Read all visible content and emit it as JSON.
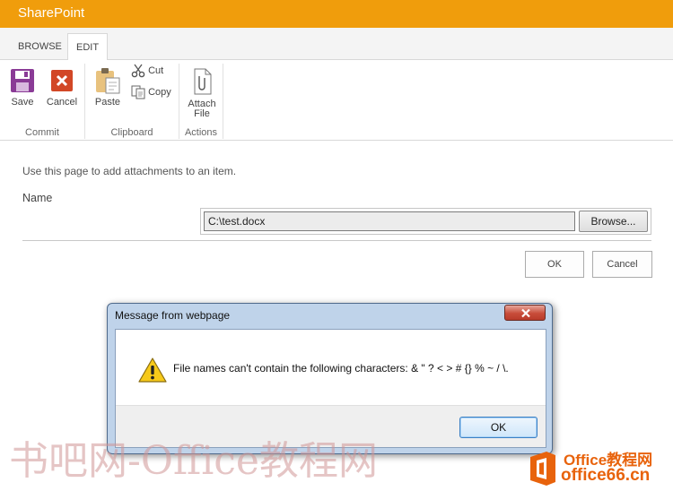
{
  "suite_bar": {
    "brand": "SharePoint",
    "color": "#f09d0c"
  },
  "ribbon": {
    "tabs": [
      {
        "label": "BROWSE",
        "active": false
      },
      {
        "label": "EDIT",
        "active": true
      }
    ],
    "groups": {
      "commit": {
        "label": "Commit",
        "save": "Save",
        "cancel": "Cancel"
      },
      "clipboard": {
        "label": "Clipboard",
        "paste": "Paste",
        "cut": "Cut",
        "copy": "Copy"
      },
      "actions": {
        "label": "Actions",
        "attach_line1": "Attach",
        "attach_line2": "File"
      }
    }
  },
  "form": {
    "instructions": "Use this page to add attachments to an item.",
    "name_label": "Name",
    "file_value": "C:\\test.docx",
    "browse_label": "Browse...",
    "ok_label": "OK",
    "cancel_label": "Cancel"
  },
  "dialog": {
    "title": "Message from webpage",
    "message": "File names can't contain the following characters: & \" ? < > # {} % ~ / \\.",
    "ok_label": "OK",
    "icon": "warning-icon"
  },
  "watermarks": {
    "left": "书吧网-Office教程网",
    "right_line1": "Office教程网",
    "right_line2": "office66.cn"
  }
}
